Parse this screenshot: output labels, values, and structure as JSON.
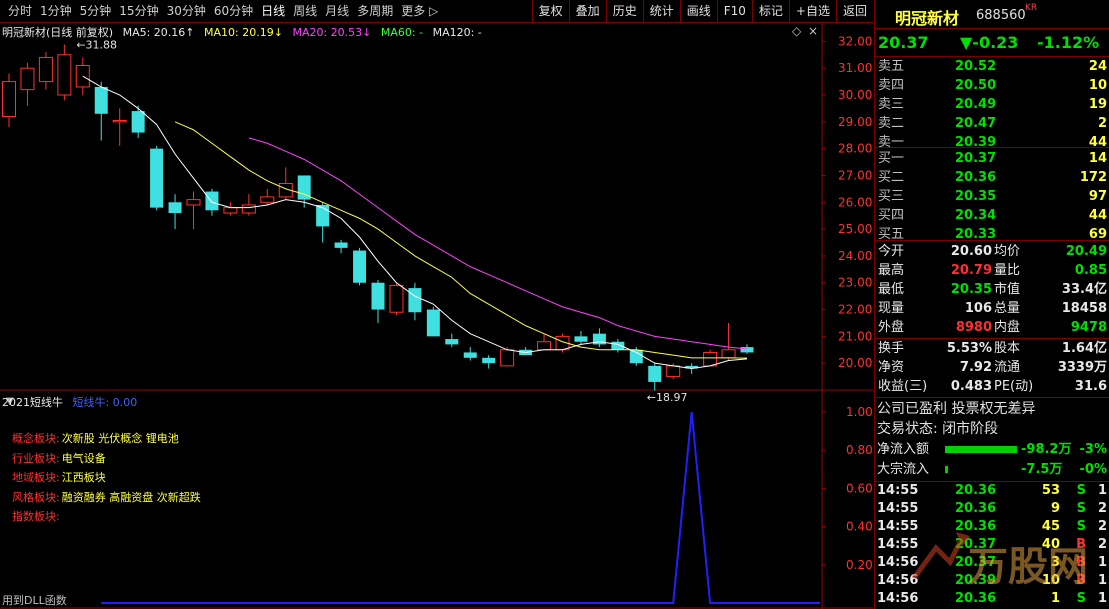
{
  "toolbar": {
    "periods": [
      "分时",
      "1分钟",
      "5分钟",
      "15分钟",
      "30分钟",
      "60分钟",
      "日线",
      "周线",
      "月线",
      "多周期",
      "更多 ▷"
    ],
    "active_period": "日线",
    "right_buttons": [
      "复权",
      "叠加",
      "历史",
      "统计",
      "画线",
      "F10",
      "标记",
      "+自选",
      "返回"
    ]
  },
  "legend": {
    "title": "明冠新材(日线 前复权)",
    "ma5": "MA5: 20.16↑",
    "ma10": "MA10: 20.19↓",
    "ma20": "MA20: 20.53↓",
    "ma60": "MA60: -",
    "ma120": "MA120: -"
  },
  "colors": {
    "up": "#ff3030",
    "down": "#40e0e0",
    "ma5": "#ffffff",
    "ma10": "#ffff40",
    "ma20": "#ff40ff",
    "ma60": "#40ff40",
    "ma120": "#c0c0c0"
  },
  "y_axis": [
    "32.00",
    "31.00",
    "30.00",
    "29.00",
    "28.00",
    "27.00",
    "26.00",
    "25.00",
    "24.00",
    "23.00",
    "22.00",
    "21.00",
    "20.00"
  ],
  "high_label": "31.88",
  "low_label": "18.97",
  "indicator": {
    "title": "2021短线牛",
    "sub": "短线牛: 0.00",
    "y_axis": [
      "1.00",
      "0.80",
      "0.60",
      "0.40",
      "0.20"
    ],
    "lines": [
      {
        "k": "概念板块:",
        "v": "次新股 光伏概念 锂电池"
      },
      {
        "k": "行业板块:",
        "v": "电气设备"
      },
      {
        "k": "地域板块:",
        "v": "江西板块"
      },
      {
        "k": "风格板块:",
        "v": "融资融券 高融资盘 次新超跌"
      },
      {
        "k": "指数板块:",
        "v": ""
      }
    ],
    "footer": "用到DLL函数"
  },
  "chart_data": {
    "type": "candlestick",
    "ylim": [
      19.0,
      32.2
    ],
    "candles": [
      {
        "o": 29.2,
        "c": 30.5,
        "h": 30.8,
        "l": 28.8
      },
      {
        "o": 30.2,
        "c": 31.0,
        "h": 31.2,
        "l": 29.6
      },
      {
        "o": 30.5,
        "c": 31.4,
        "h": 31.6,
        "l": 30.2
      },
      {
        "o": 30.0,
        "c": 31.5,
        "h": 31.88,
        "l": 29.8
      },
      {
        "o": 30.3,
        "c": 31.1,
        "h": 31.4,
        "l": 30.0
      },
      {
        "o": 30.3,
        "c": 29.3,
        "h": 30.5,
        "l": 28.3
      },
      {
        "o": 29.0,
        "c": 29.05,
        "h": 29.5,
        "l": 28.1
      },
      {
        "o": 29.4,
        "c": 28.6,
        "h": 29.6,
        "l": 28.4
      },
      {
        "o": 28.0,
        "c": 25.8,
        "h": 28.1,
        "l": 25.7
      },
      {
        "o": 26.0,
        "c": 25.6,
        "h": 26.3,
        "l": 25.0
      },
      {
        "o": 25.9,
        "c": 26.1,
        "h": 26.4,
        "l": 25.0
      },
      {
        "o": 26.4,
        "c": 25.7,
        "h": 26.5,
        "l": 25.5
      },
      {
        "o": 25.6,
        "c": 25.8,
        "h": 26.0,
        "l": 25.5
      },
      {
        "o": 25.6,
        "c": 25.9,
        "h": 26.3,
        "l": 25.5
      },
      {
        "o": 26.0,
        "c": 26.2,
        "h": 26.5,
        "l": 25.9
      },
      {
        "o": 26.2,
        "c": 26.7,
        "h": 27.3,
        "l": 26.1
      },
      {
        "o": 27.0,
        "c": 26.1,
        "h": 27.0,
        "l": 25.8
      },
      {
        "o": 25.9,
        "c": 25.1,
        "h": 26.0,
        "l": 24.5
      },
      {
        "o": 24.5,
        "c": 24.3,
        "h": 24.6,
        "l": 24.1
      },
      {
        "o": 24.2,
        "c": 23.0,
        "h": 24.3,
        "l": 22.9
      },
      {
        "o": 23.0,
        "c": 22.0,
        "h": 23.1,
        "l": 21.5
      },
      {
        "o": 21.9,
        "c": 22.9,
        "h": 23.0,
        "l": 21.8
      },
      {
        "o": 22.8,
        "c": 21.9,
        "h": 23.0,
        "l": 21.6
      },
      {
        "o": 22.0,
        "c": 21.0,
        "h": 22.1,
        "l": 21.0
      },
      {
        "o": 20.9,
        "c": 20.7,
        "h": 21.1,
        "l": 20.6
      },
      {
        "o": 20.4,
        "c": 20.2,
        "h": 20.6,
        "l": 20.1
      },
      {
        "o": 20.2,
        "c": 20.0,
        "h": 20.3,
        "l": 19.8
      },
      {
        "o": 19.9,
        "c": 20.5,
        "h": 20.6,
        "l": 19.9
      },
      {
        "o": 20.5,
        "c": 20.3,
        "h": 20.6,
        "l": 20.3
      },
      {
        "o": 20.5,
        "c": 20.8,
        "h": 21.1,
        "l": 20.5
      },
      {
        "o": 20.5,
        "c": 21.0,
        "h": 21.1,
        "l": 20.4
      },
      {
        "o": 21.0,
        "c": 20.8,
        "h": 21.2,
        "l": 20.7
      },
      {
        "o": 21.1,
        "c": 20.7,
        "h": 21.3,
        "l": 20.6
      },
      {
        "o": 20.8,
        "c": 20.5,
        "h": 20.9,
        "l": 20.4
      },
      {
        "o": 20.5,
        "c": 20.0,
        "h": 20.6,
        "l": 19.9
      },
      {
        "o": 19.9,
        "c": 19.3,
        "h": 20.0,
        "l": 18.97
      },
      {
        "o": 19.5,
        "c": 19.9,
        "h": 20.0,
        "l": 19.4
      },
      {
        "o": 19.9,
        "c": 19.8,
        "h": 20.0,
        "l": 19.6
      },
      {
        "o": 19.9,
        "c": 20.4,
        "h": 20.5,
        "l": 19.9
      },
      {
        "o": 20.2,
        "c": 20.5,
        "h": 21.5,
        "l": 20.1
      },
      {
        "o": 20.6,
        "c": 20.4,
        "h": 20.7,
        "l": 20.35
      }
    ],
    "ma5": [
      null,
      null,
      null,
      null,
      30.7,
      30.3,
      30.0,
      29.5,
      28.9,
      27.8,
      26.9,
      26.0,
      25.8,
      25.8,
      25.9,
      26.1,
      26.0,
      25.8,
      25.4,
      24.7,
      23.8,
      23.0,
      22.5,
      22.2,
      21.6,
      21.1,
      20.8,
      20.5,
      20.4,
      20.5,
      20.5,
      20.7,
      20.8,
      20.7,
      20.4,
      20.0,
      19.9,
      19.8,
      19.9,
      20.1,
      20.16
    ],
    "ma10": [
      null,
      null,
      null,
      null,
      null,
      null,
      null,
      null,
      null,
      29.0,
      28.7,
      28.2,
      27.7,
      27.2,
      26.8,
      26.5,
      26.3,
      26.0,
      25.7,
      25.4,
      25.0,
      24.5,
      24.0,
      23.6,
      23.2,
      22.6,
      22.2,
      21.8,
      21.4,
      21.1,
      20.8,
      20.6,
      20.5,
      20.5,
      20.5,
      20.4,
      20.3,
      20.2,
      20.2,
      20.2,
      20.19
    ],
    "ma20": [
      null,
      null,
      null,
      null,
      null,
      null,
      null,
      null,
      null,
      null,
      null,
      null,
      null,
      28.4,
      28.2,
      27.9,
      27.6,
      27.2,
      26.8,
      26.3,
      25.8,
      25.3,
      24.8,
      24.4,
      24.0,
      23.6,
      23.3,
      23.0,
      22.7,
      22.4,
      22.1,
      21.9,
      21.7,
      21.4,
      21.2,
      21.0,
      20.9,
      20.8,
      20.7,
      20.6,
      20.53
    ],
    "indicator_values": [
      0,
      0,
      0,
      0,
      0,
      0,
      0,
      0,
      0,
      0,
      0,
      0,
      0,
      0,
      0,
      0,
      0,
      0,
      0,
      0,
      0,
      0,
      0,
      0,
      0,
      0,
      0,
      0,
      0,
      0,
      0,
      0,
      0,
      0,
      0,
      0,
      0,
      1,
      0,
      0,
      0
    ]
  },
  "quote": {
    "name": "明冠新材",
    "code": "688560",
    "tag": "KR",
    "price": "20.37",
    "change": "▼-0.23",
    "pct": "-1.12%",
    "asks": [
      {
        "l": "卖五",
        "p": "20.52",
        "q": "24"
      },
      {
        "l": "卖四",
        "p": "20.50",
        "q": "10"
      },
      {
        "l": "卖三",
        "p": "20.49",
        "q": "19"
      },
      {
        "l": "卖二",
        "p": "20.47",
        "q": "2"
      },
      {
        "l": "卖一",
        "p": "20.39",
        "q": "44"
      }
    ],
    "bids": [
      {
        "l": "买一",
        "p": "20.37",
        "q": "14"
      },
      {
        "l": "买二",
        "p": "20.36",
        "q": "172"
      },
      {
        "l": "买三",
        "p": "20.35",
        "q": "97"
      },
      {
        "l": "买四",
        "p": "20.34",
        "q": "44"
      },
      {
        "l": "买五",
        "p": "20.33",
        "q": "69"
      }
    ],
    "stats": [
      {
        "l1": "今开",
        "v1": "20.60",
        "c1": "white",
        "l2": "均价",
        "v2": "20.49",
        "c2": "green"
      },
      {
        "l1": "最高",
        "v1": "20.79",
        "c1": "red",
        "l2": "量比",
        "v2": "0.85",
        "c2": "green"
      },
      {
        "l1": "最低",
        "v1": "20.35",
        "c1": "green",
        "l2": "市值",
        "v2": "33.4亿",
        "c2": "white"
      },
      {
        "l1": "现量",
        "v1": "106",
        "c1": "white",
        "l2": "总量",
        "v2": "18458",
        "c2": "white"
      },
      {
        "l1": "外盘",
        "v1": "8980",
        "c1": "red",
        "l2": "内盘",
        "v2": "9478",
        "c2": "green"
      }
    ],
    "stats2": [
      {
        "l1": "换手",
        "v1": "5.53%",
        "c1": "white",
        "l2": "股本",
        "v2": "1.64亿",
        "c2": "white"
      },
      {
        "l1": "净资",
        "v1": "7.92",
        "c1": "white",
        "l2": "流通",
        "v2": "3339万",
        "c2": "white"
      },
      {
        "l1": "收益(三)",
        "v1": "0.483",
        "c1": "white",
        "l2": "PE(动)",
        "v2": "31.6",
        "c2": "white"
      }
    ],
    "notice": "公司已盈利 投票权无差异",
    "status": "交易状态: 闭市阶段",
    "flows": [
      {
        "l": "净流入额",
        "v": "-98.2万",
        "p": "-3%",
        "bar": 0.45
      },
      {
        "l": "大宗流入",
        "v": "-7.5万",
        "p": "-0%",
        "bar": 0.02
      }
    ],
    "ticks": [
      {
        "t": "14:55",
        "p": "20.36",
        "v": "53",
        "d": "S",
        "n": "1"
      },
      {
        "t": "14:55",
        "p": "20.36",
        "v": "9",
        "d": "S",
        "n": "2"
      },
      {
        "t": "14:55",
        "p": "20.36",
        "v": "45",
        "d": "S",
        "n": "2"
      },
      {
        "t": "14:55",
        "p": "20.37",
        "v": "40",
        "d": "B",
        "n": "2"
      },
      {
        "t": "14:56",
        "p": "20.37",
        "v": "3",
        "d": "B",
        "n": "1"
      },
      {
        "t": "14:56",
        "p": "20.39",
        "v": "10",
        "d": "B",
        "n": "1"
      },
      {
        "t": "14:56",
        "p": "20.36",
        "v": "1",
        "d": "S",
        "n": "1"
      }
    ]
  }
}
